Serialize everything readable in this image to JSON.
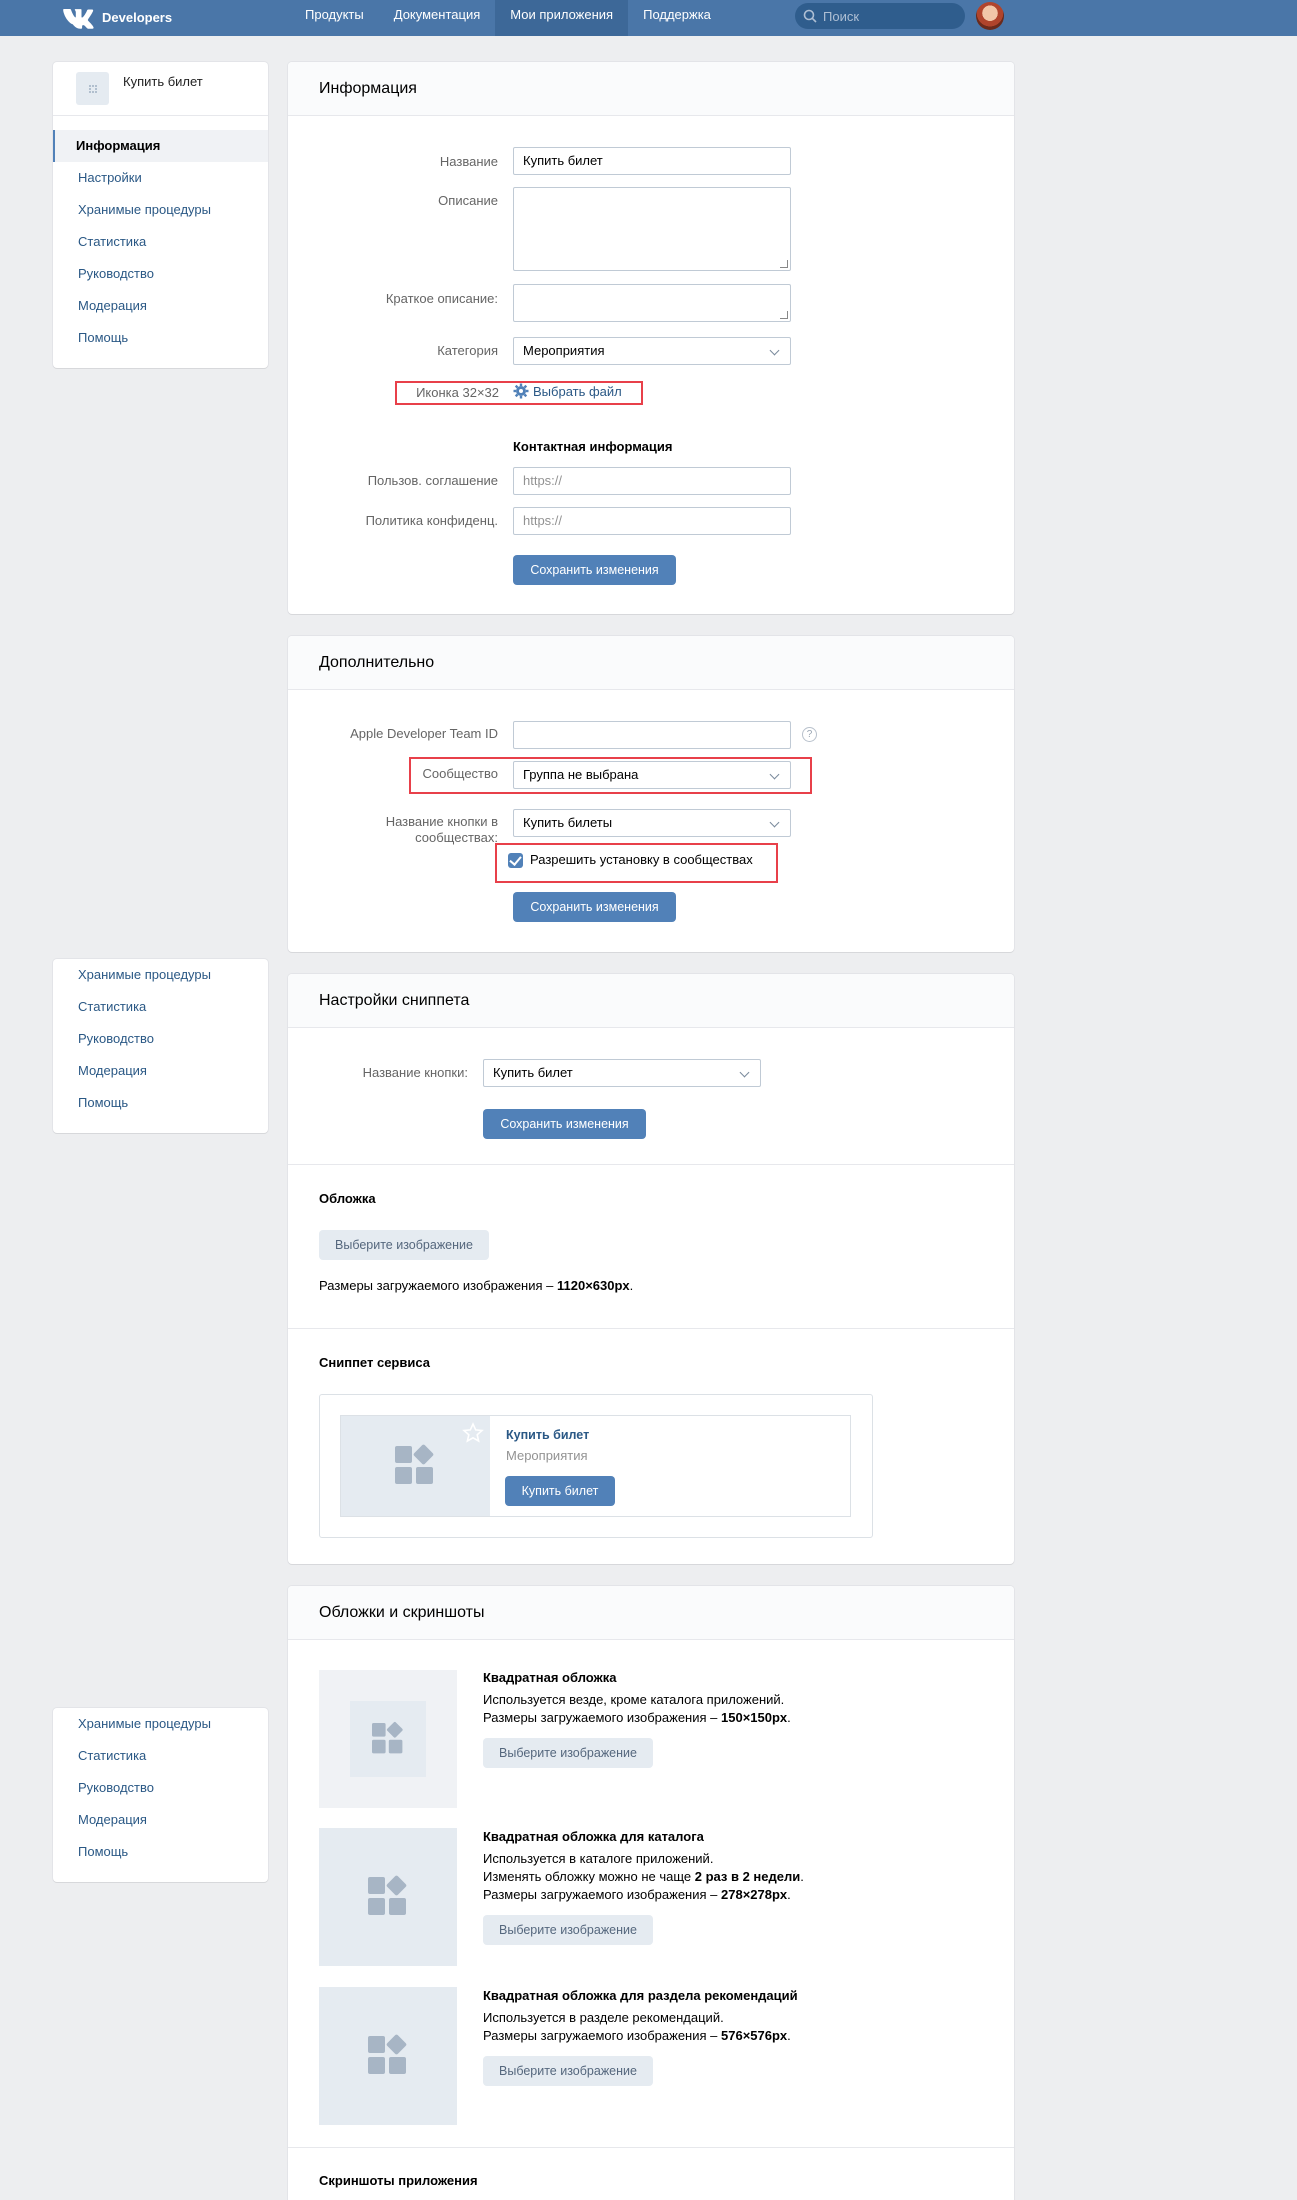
{
  "header": {
    "brand": "Developers",
    "nav": [
      "Продукты",
      "Документация",
      "Мои приложения",
      "Поддержка"
    ],
    "search_placeholder": "Поиск"
  },
  "sidebar": {
    "app_name": "Купить билет",
    "items": [
      "Информация",
      "Настройки",
      "Хранимые процедуры",
      "Статистика",
      "Руководство",
      "Модерация",
      "Помощь"
    ],
    "items_short": [
      "Хранимые процедуры",
      "Статистика",
      "Руководство",
      "Модерация",
      "Помощь"
    ]
  },
  "info": {
    "title": "Информация",
    "name_label": "Название",
    "name_value": "Купить билет",
    "desc_label": "Описание",
    "short_desc_label": "Краткое описание:",
    "category_label": "Категория",
    "category_value": "Мероприятия",
    "icon_label": "Иконка 32×32",
    "icon_link": "Выбрать файл",
    "contact_title": "Контактная информация",
    "terms_label": "Пользов. соглашение",
    "privacy_label": "Политика конфиденц.",
    "url_placeholder": "https://",
    "save": "Сохранить изменения"
  },
  "extra": {
    "title": "Дополнительно",
    "team_label": "Apple Developer Team ID",
    "community_label": "Сообщество",
    "community_value": "Группа не выбрана",
    "btn_name_label_1": "Название кнопки в",
    "btn_name_label_2": "сообществах:",
    "btn_name_value": "Купить билеты",
    "allow_install": "Разрешить установку в сообществах",
    "save": "Сохранить изменения",
    "help": "?"
  },
  "snippet": {
    "title": "Настройки сниппета",
    "button_label": "Название кнопки:",
    "button_value": "Купить билет",
    "save": "Сохранить изменения",
    "cover_title": "Обложка",
    "choose_image": "Выберите изображение",
    "cover_size_prefix": "Размеры загружаемого изображения – ",
    "cover_size": "1120×630px",
    "cover_size_suffix": ".",
    "service_title": "Сниппет сервиса",
    "preview_name": "Купить билет",
    "preview_category": "Мероприятия",
    "preview_button": "Купить билет"
  },
  "covers": {
    "title": "Обложки и скриншоты",
    "items": [
      {
        "title": "Квадратная обложка",
        "line1": "Используется везде, кроме каталога приложений.",
        "line2_prefix": "Размеры загружаемого изображения – ",
        "line2_bold": "150×150px",
        "line2_suffix": "."
      },
      {
        "title": "Квадратная обложка для каталога",
        "line1": "Используется в каталоге приложений.",
        "line_mid_prefix": "Изменять обложку можно не чаще ",
        "line_mid_bold": "2 раз в 2 недели",
        "line_mid_suffix": ".",
        "line2_prefix": "Размеры загружаемого изображения – ",
        "line2_bold": "278×278px",
        "line2_suffix": "."
      },
      {
        "title": "Квадратная обложка для раздела рекомендаций",
        "line1": "Используется в разделе рекомендаций.",
        "line2_prefix": "Размеры загружаемого изображения – ",
        "line2_bold": "576×576px",
        "line2_suffix": "."
      }
    ],
    "choose_image": "Выберите изображение",
    "screens_title": "Скриншоты приложения"
  },
  "colors": {
    "accent": "#5181b8",
    "header": "#4a76a8",
    "highlight": "#e8404a"
  }
}
